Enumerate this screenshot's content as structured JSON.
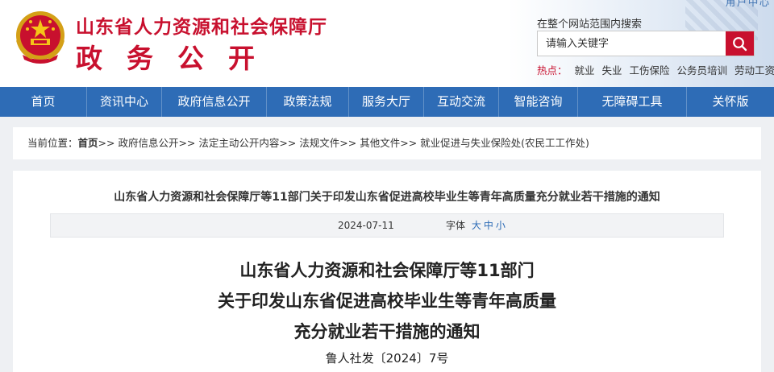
{
  "header": {
    "site_name": "山东省人力资源和社会保障厅",
    "site_sub": "政务公开",
    "top_link": "用户中心",
    "search_hint": "在整个网站范围内搜索",
    "search_placeholder": "请输入关键字",
    "hot_label": "热点：",
    "hot_items": [
      "就业",
      "失业",
      "工伤保险",
      "公务员培训",
      "劳动工资"
    ]
  },
  "nav": {
    "items": [
      "首页",
      "资讯中心",
      "政府信息公开",
      "政策法规",
      "服务大厅",
      "互动交流",
      "智能咨询",
      "无障碍工具",
      "关怀版"
    ]
  },
  "breadcrumb": {
    "prefix": "当前位置：",
    "home": "首页",
    "path": ">> 政府信息公开>> 法定主动公开内容>> 法规文件>> 其他文件>> 就业促进与失业保险处(农民工工作处)"
  },
  "article": {
    "title": "山东省人力资源和社会保障厅等11部门关于印发山东省促进高校毕业生等青年高质量充分就业若干措施的通知",
    "date": "2024-07-11",
    "font_label": "字体",
    "font_sizes": [
      "大",
      "中",
      "小"
    ],
    "headline": [
      "山东省人力资源和社会保障厅等11部门",
      "关于印发山东省促进高校毕业生等青年高质量",
      "充分就业若干措施的通知"
    ],
    "doc_no": "鲁人社发〔2024〕7号"
  },
  "colors": {
    "brand_red": "#c8102e",
    "nav_blue": "#2e6cb6",
    "page_bg": "#eef0f3"
  },
  "icons": {
    "emblem": "national-emblem-icon",
    "search": "search-icon"
  }
}
